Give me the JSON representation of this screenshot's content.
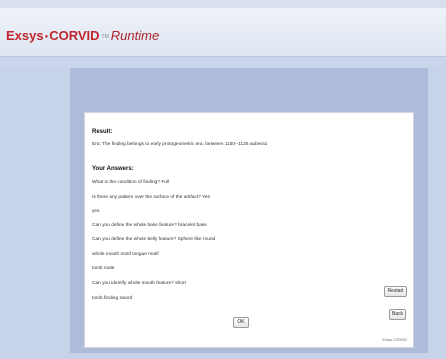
{
  "app": {
    "logo_main": "Exsys",
    "logo_brand": "CORVID",
    "logo_tm": "TM",
    "logo_runtime": "Runtime"
  },
  "result": {
    "heading": "Result:",
    "text": "Era: The finding belongs to early protogeometric era, between 1150--1125 aubera1"
  },
  "answers": {
    "heading": "Your Answers:",
    "lines": [
      "What is the condition of finding? Full",
      "Is there any pattern over the surface of the artifact? Yes",
      "yes",
      "Can you define the whole base feature? bracelet base",
      "Can you define the whole belly feature? Sphere like round",
      "whole mouth motif tongue motif",
      "tomb male",
      "Can you identify whole mouth feature? short",
      "tomb finding sword"
    ]
  },
  "buttons": {
    "ok": "OK",
    "restart": "Restart",
    "back": "Back"
  },
  "footer": {
    "note": "Exsys CORVID"
  }
}
